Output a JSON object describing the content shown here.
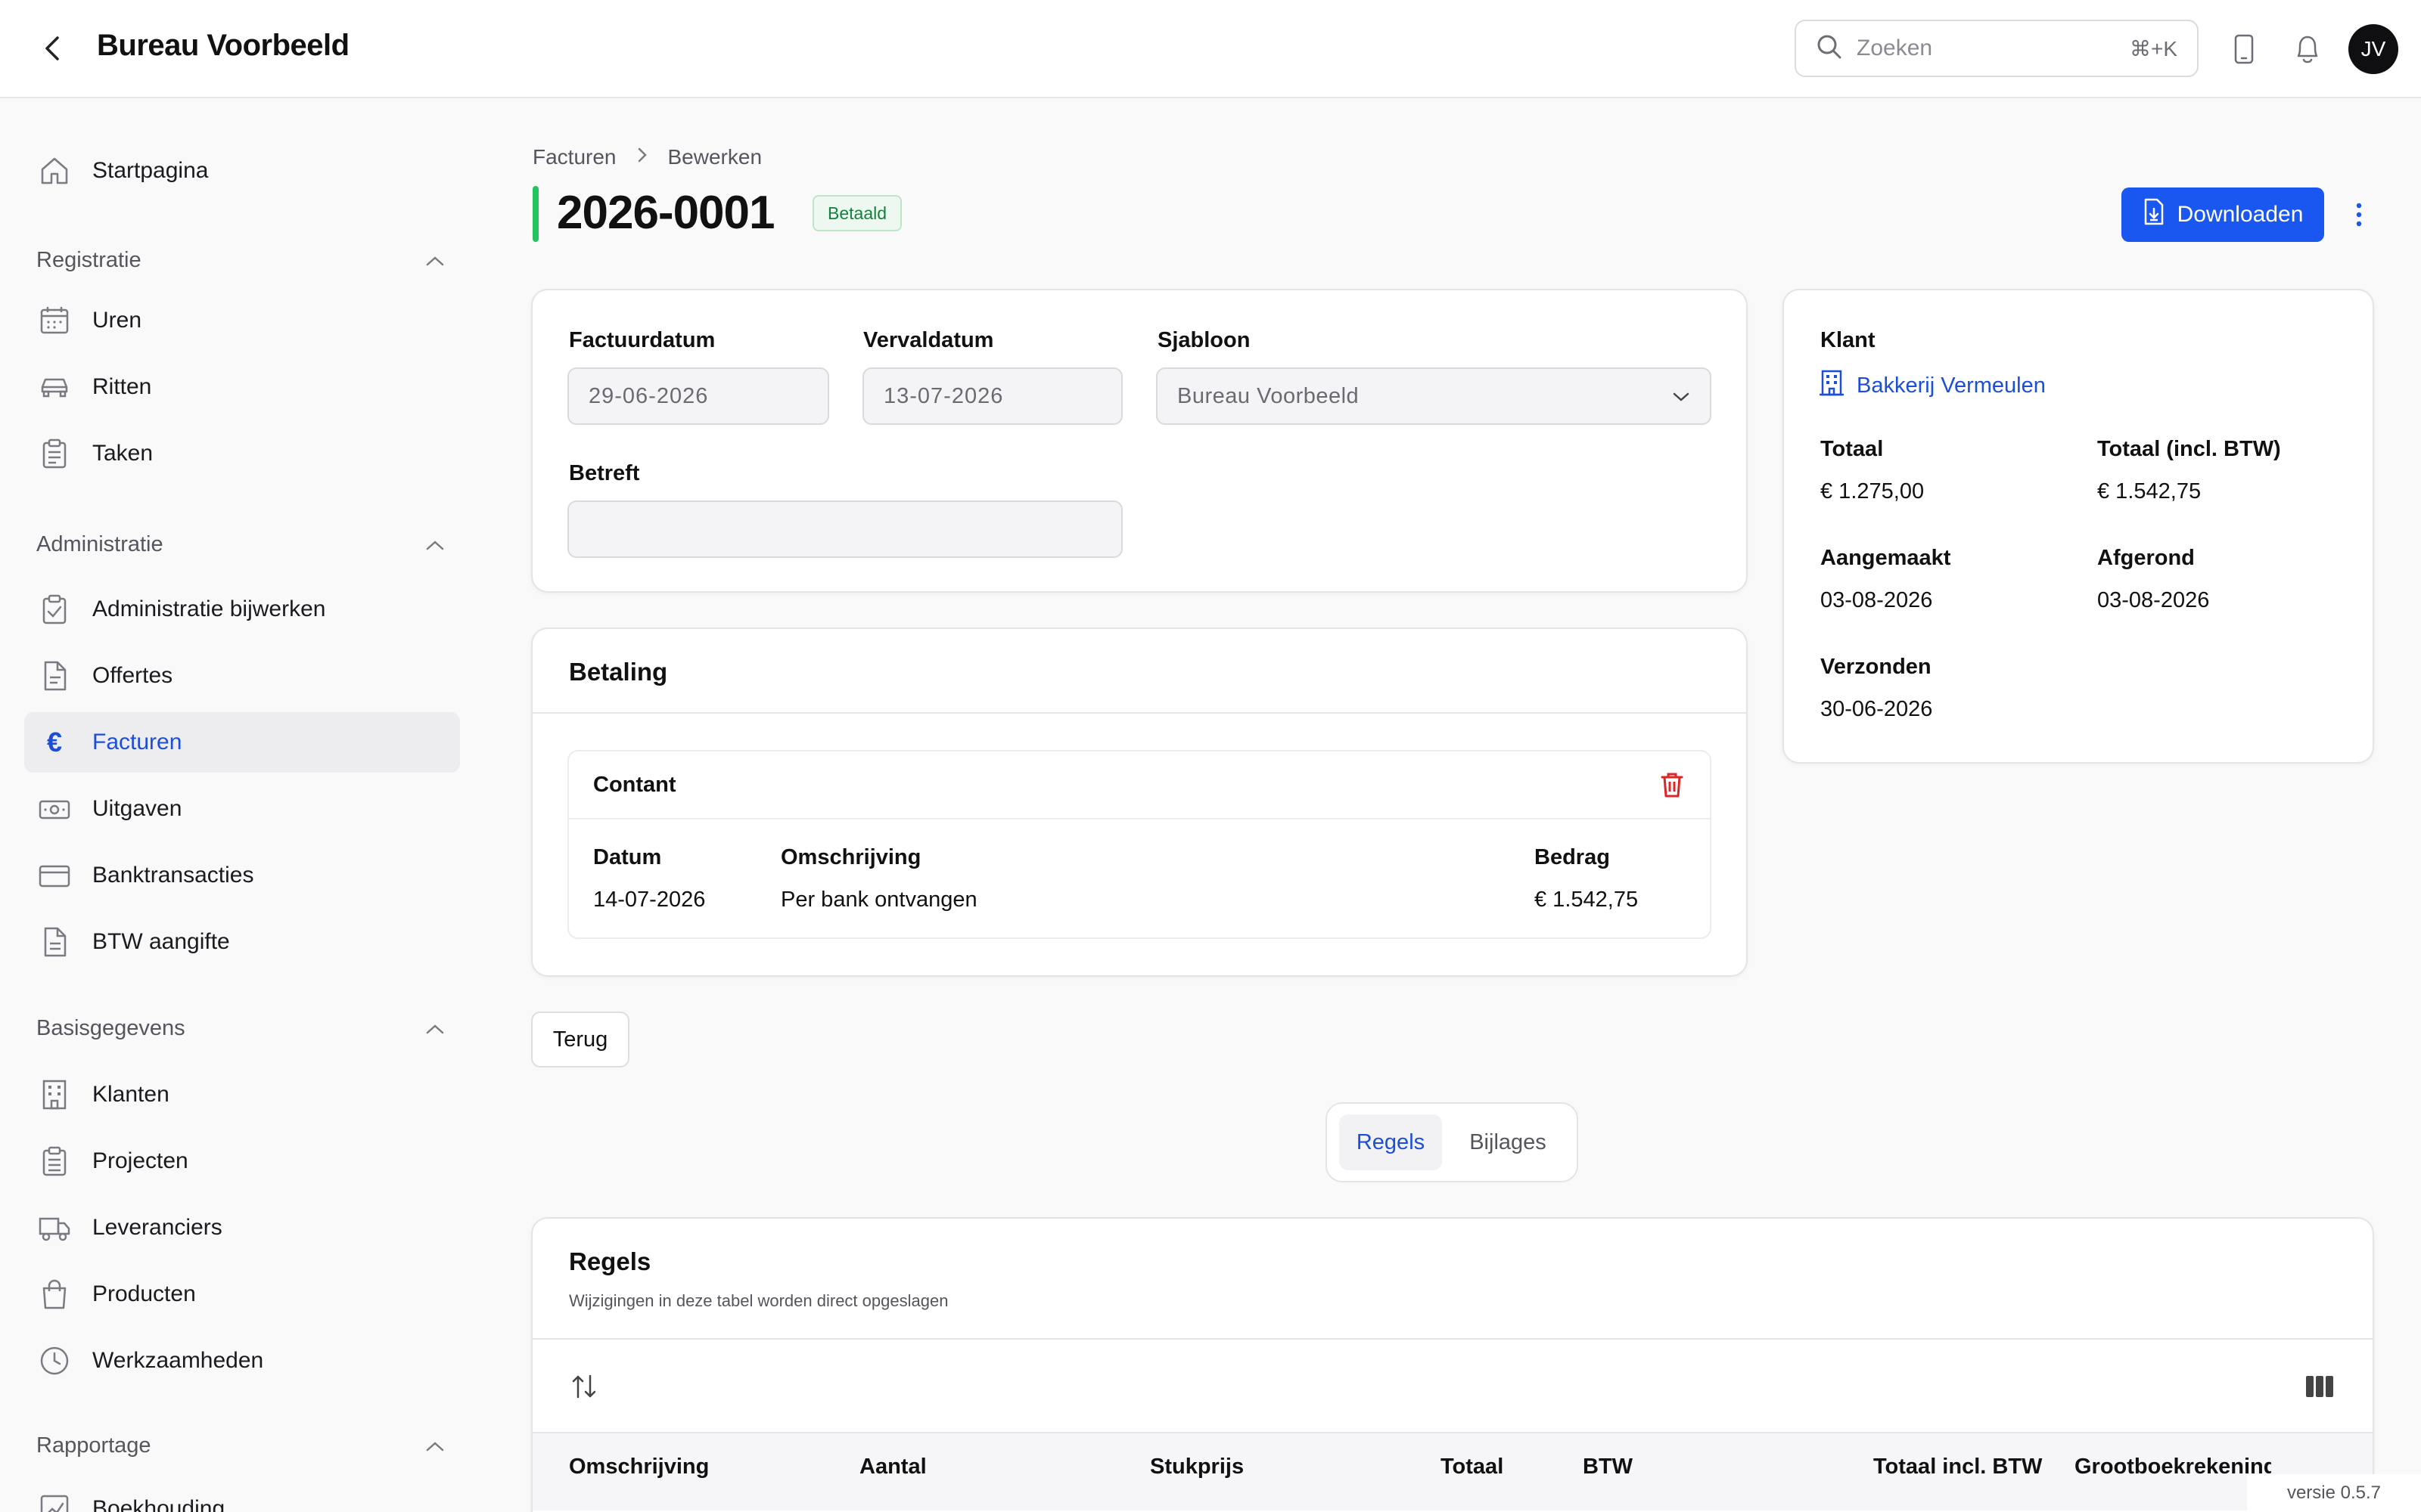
{
  "header": {
    "title": "Bureau Voorbeeld",
    "search_placeholder": "Zoeken",
    "search_shortcut": "⌘+K",
    "avatar_initials": "JV"
  },
  "sidebar": {
    "home": "Startpagina",
    "sections": [
      {
        "label": "Registratie",
        "items": [
          "Uren",
          "Ritten",
          "Taken"
        ]
      },
      {
        "label": "Administratie",
        "items": [
          "Administratie bijwerken",
          "Offertes",
          "Facturen",
          "Uitgaven",
          "Banktransacties",
          "BTW aangifte"
        ]
      },
      {
        "label": "Basisgegevens",
        "items": [
          "Klanten",
          "Projecten",
          "Leveranciers",
          "Producten",
          "Werkzaamheden"
        ]
      },
      {
        "label": "Rapportage",
        "items": [
          "Boekhouding"
        ]
      }
    ],
    "active_item": "Facturen"
  },
  "breadcrumb": {
    "parent": "Facturen",
    "current": "Bewerken"
  },
  "page": {
    "title": "2026-0001",
    "status": "Betaald",
    "status_color": "#15803d",
    "accent_color": "#22c55e",
    "download_label": "Downloaden",
    "primary_color": "#1a56f0"
  },
  "form": {
    "invoice_date_label": "Factuurdatum",
    "invoice_date_value": "29-06-2026",
    "due_date_label": "Vervaldatum",
    "due_date_value": "13-07-2026",
    "template_label": "Sjabloon",
    "template_value": "Bureau Voorbeeld",
    "subject_label": "Betreft",
    "subject_value": ""
  },
  "summary": {
    "client_label": "Klant",
    "client_name": "Bakkerij Vermeulen",
    "total_label": "Totaal",
    "total_value": "€ 1.275,00",
    "total_incl_label": "Totaal (incl. BTW)",
    "total_incl_value": "€ 1.542,75",
    "created_label": "Aangemaakt",
    "created_value": "03-08-2026",
    "completed_label": "Afgerond",
    "completed_value": "03-08-2026",
    "sent_label": "Verzonden",
    "sent_value": "30-06-2026"
  },
  "payment": {
    "title": "Betaling",
    "method": "Contant",
    "columns": [
      "Datum",
      "Omschrijving",
      "Bedrag"
    ],
    "row": {
      "date": "14-07-2026",
      "description": "Per bank ontvangen",
      "amount": "€ 1.542,75"
    }
  },
  "back_label": "Terug",
  "tabs": {
    "active": "Regels",
    "other": "Bijlages"
  },
  "lines": {
    "title": "Regels",
    "subtitle": "Wijzigingen in deze tabel worden direct opgeslagen",
    "columns": [
      "Omschrijving",
      "Aantal",
      "Stukprijs",
      "Totaal",
      "BTW",
      "Totaal incl. BTW",
      "Grootboekrekening"
    ]
  },
  "version": "versie 0.5.7"
}
